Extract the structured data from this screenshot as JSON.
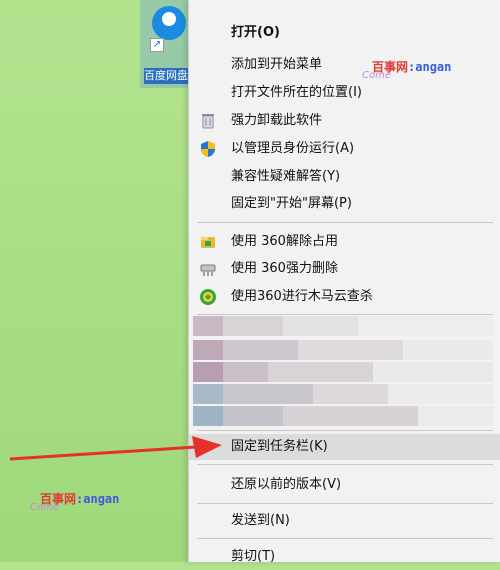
{
  "desktop": {
    "icon_label": "百度网盘",
    "shortcut_glyph": "↗"
  },
  "context_menu": {
    "items": [
      {
        "label": "打开(O)",
        "icon": "none",
        "bold": true
      },
      {
        "label": "添加到开始菜单",
        "icon": "none"
      },
      {
        "label": "打开文件所在的位置(I)",
        "icon": "none"
      },
      {
        "label": "强力卸载此软件",
        "icon": "trash-icon"
      },
      {
        "label": "以管理员身份运行(A)",
        "icon": "uac-shield-icon"
      },
      {
        "label": "兼容性疑难解答(Y)",
        "icon": "none"
      },
      {
        "label": "固定到\"开始\"屏幕(P)",
        "icon": "none"
      },
      {
        "label": "使用 360解除占用",
        "icon": "360-unlock-icon"
      },
      {
        "label": "使用 360强力删除",
        "icon": "360-shred-icon"
      },
      {
        "label": "使用360进行木马云查杀",
        "icon": "360-trojan-scan-icon"
      },
      {
        "label": "固定到任务栏(K)",
        "icon": "none",
        "highlighted": true
      },
      {
        "label": "还原以前的版本(V)",
        "icon": "none"
      },
      {
        "label": "发送到(N)",
        "icon": "none"
      },
      {
        "label": "剪切(T)",
        "icon": "none"
      }
    ]
  },
  "watermark": {
    "cn": "百事网",
    "roman": ":angan",
    "script": "Come"
  },
  "colors": {
    "arrow": "#e8302a",
    "highlight": "#dcdcdc",
    "menu_bg": "#f2f2f2"
  }
}
